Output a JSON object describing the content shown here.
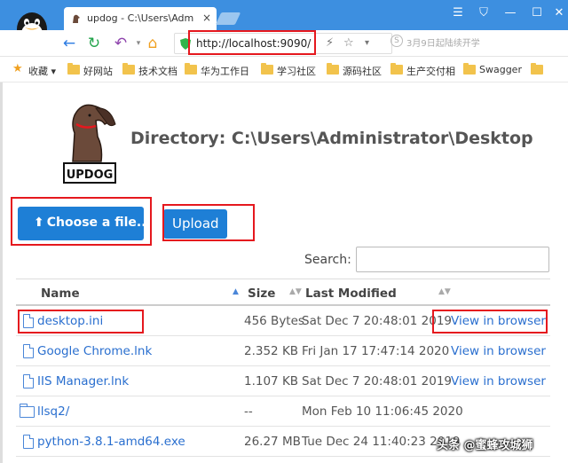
{
  "browser": {
    "tab_title": "updog - C:\\Users\\Adm",
    "tab_close": "×",
    "address_url": "http://localhost:9090/",
    "address_hint": "3月9日起陆续开学",
    "window_buttons": [
      "☰",
      "⛉",
      "—",
      "☐",
      "✕"
    ]
  },
  "bookmarks": [
    {
      "label": "收藏",
      "icon": "star-icon"
    },
    {
      "label": "好网站",
      "icon": "folder-icon"
    },
    {
      "label": "技术文档",
      "icon": "folder-icon"
    },
    {
      "label": "华为工作日",
      "icon": "folder-icon"
    },
    {
      "label": "学习社区",
      "icon": "folder-icon"
    },
    {
      "label": "源码社区",
      "icon": "folder-icon"
    },
    {
      "label": "生产交付相",
      "icon": "folder-icon"
    },
    {
      "label": "Swagger",
      "icon": "folder-icon"
    }
  ],
  "page": {
    "logo_text": "UPDOG",
    "heading": "Directory: C:\\Users\\Administrator\\Desktop",
    "choose_button": "Choose a file...",
    "upload_button": "Upload",
    "search_label": "Search:",
    "search_value": ""
  },
  "table": {
    "headers": {
      "name": "Name",
      "size": "Size",
      "modified": "Last Modified"
    },
    "sort_glyph": "▲",
    "sort_glyph_both": "▲▼",
    "rows": [
      {
        "type": "file",
        "name": "desktop.ini",
        "size": "456 Bytes",
        "modified": "Sat Dec 7 20:48:01 2019",
        "view": "View in browser"
      },
      {
        "type": "file",
        "name": "Google Chrome.lnk",
        "size": "2.352 KB",
        "modified": "Fri Jan 17 17:47:14 2020",
        "view": "View in browser"
      },
      {
        "type": "file",
        "name": "IIS Manager.lnk",
        "size": "1.107 KB",
        "modified": "Sat Dec 7 20:48:01 2019",
        "view": "View in browser"
      },
      {
        "type": "folder",
        "name": "llsq2/",
        "size": "--",
        "modified": "Mon Feb 10 11:06:45 2020",
        "view": ""
      },
      {
        "type": "file",
        "name": "python-3.8.1-amd64.exe",
        "size": "26.27 MB",
        "modified": "Tue Dec 24 11:40:23 2019",
        "view": ""
      }
    ]
  },
  "watermark": "头条 @蜜蜂攻城狮",
  "colors": {
    "accent": "#1e7fd6",
    "link": "#2a6fcf",
    "highlight": "#e5181e",
    "titlebar": "#3d8fe0"
  }
}
